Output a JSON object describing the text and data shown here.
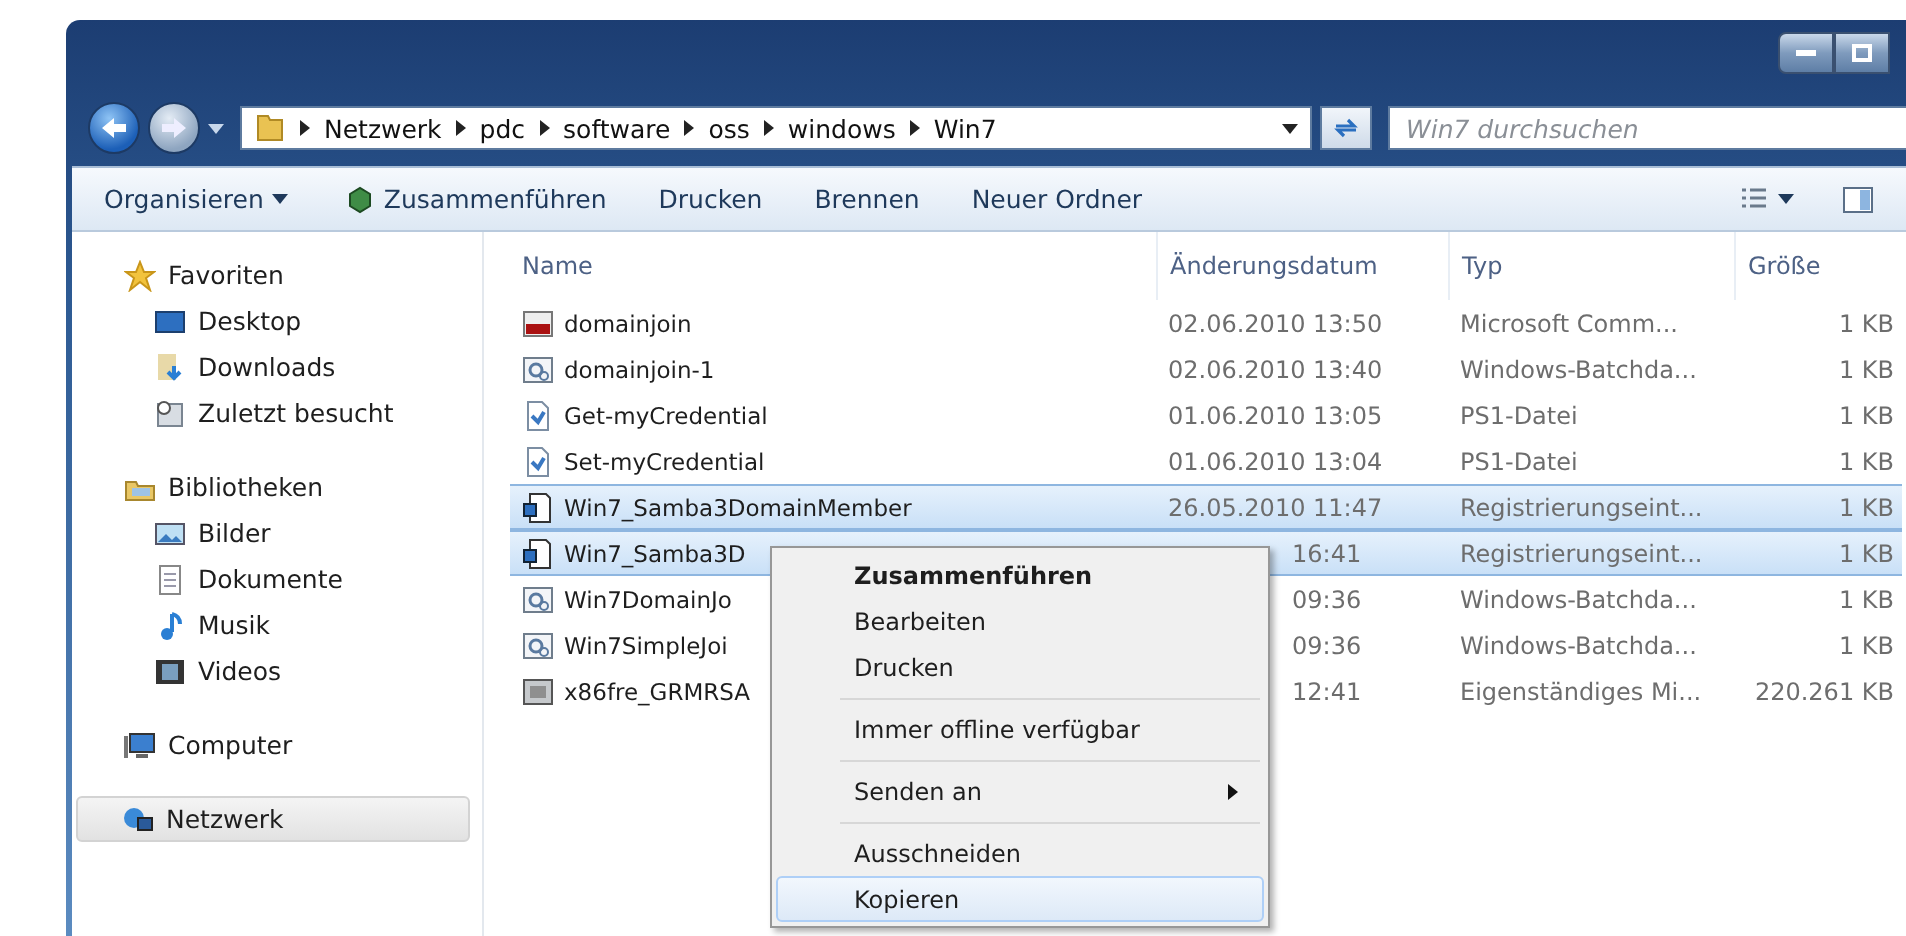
{
  "address_bar": {
    "path": [
      "Netzwerk",
      "pdc",
      "software",
      "oss",
      "windows",
      "Win7"
    ]
  },
  "search": {
    "placeholder": "Win7 durchsuchen"
  },
  "toolbar": {
    "items": [
      {
        "label": "Organisieren",
        "kind": "menu"
      },
      {
        "label": "Zusammenführen",
        "kind": "icon"
      },
      {
        "label": "Drucken",
        "kind": "plain"
      },
      {
        "label": "Brennen",
        "kind": "plain"
      },
      {
        "label": "Neuer Ordner",
        "kind": "plain"
      }
    ]
  },
  "sidebar": {
    "groups": [
      {
        "label": "Favoriten",
        "kind": "star",
        "selected": false,
        "children": [
          {
            "label": "Desktop",
            "kind": "desktop"
          },
          {
            "label": "Downloads",
            "kind": "downloads"
          },
          {
            "label": "Zuletzt besucht",
            "kind": "recent"
          }
        ]
      },
      {
        "label": "Bibliotheken",
        "kind": "library",
        "selected": false,
        "children": [
          {
            "label": "Bilder",
            "kind": "pictures"
          },
          {
            "label": "Dokumente",
            "kind": "documents"
          },
          {
            "label": "Musik",
            "kind": "music"
          },
          {
            "label": "Videos",
            "kind": "videos"
          }
        ]
      },
      {
        "label": "Computer",
        "kind": "computer",
        "selected": false
      },
      {
        "label": "Netzwerk",
        "kind": "network",
        "selected": true
      }
    ]
  },
  "table": {
    "columns": [
      "Name",
      "Änderungsdatum",
      "Typ",
      "Größe"
    ],
    "rows": [
      {
        "kind": "app",
        "name": "domainjoin",
        "date": "02.06.2010 13:50",
        "type": "Microsoft Comm...",
        "size": "1 KB",
        "selected": false,
        "partial": false
      },
      {
        "kind": "batch",
        "name": "domainjoin-1",
        "date": "02.06.2010 13:40",
        "type": "Windows-Batchda...",
        "size": "1 KB",
        "selected": false,
        "partial": false
      },
      {
        "kind": "script",
        "name": "Get-myCredential",
        "date": "01.06.2010 13:05",
        "type": "PS1-Datei",
        "size": "1 KB",
        "selected": false,
        "partial": false
      },
      {
        "kind": "script",
        "name": "Set-myCredential",
        "date": "01.06.2010 13:04",
        "type": "PS1-Datei",
        "size": "1 KB",
        "selected": false,
        "partial": false
      },
      {
        "kind": "registry",
        "name": "Win7_Samba3DomainMember",
        "date": "26.05.2010 11:47",
        "type": "Registrierungseint...",
        "size": "1 KB",
        "selected": true,
        "partial": false
      },
      {
        "kind": "registry",
        "name": "Win7_Samba3D",
        "date": "16:41",
        "type": "Registrierungseint...",
        "size": "1 KB",
        "selected": true,
        "partial": true
      },
      {
        "kind": "batch",
        "name": "Win7DomainJo",
        "date": "09:36",
        "type": "Windows-Batchda...",
        "size": "1 KB",
        "selected": false,
        "partial": true
      },
      {
        "kind": "batch",
        "name": "Win7SimpleJoi",
        "date": "09:36",
        "type": "Windows-Batchda...",
        "size": "1 KB",
        "selected": false,
        "partial": true
      },
      {
        "kind": "installer",
        "name": "x86fre_GRMRSA",
        "date": "12:41",
        "type": "Eigenständiges Mi...",
        "size": "220.261 KB",
        "selected": false,
        "partial": true
      }
    ]
  },
  "context_menu": {
    "sections": [
      [
        {
          "label": "Zusammenführen",
          "default": true,
          "submenu": false,
          "selected": false
        },
        {
          "label": "Bearbeiten",
          "default": false,
          "submenu": false,
          "selected": false
        },
        {
          "label": "Drucken",
          "default": false,
          "submenu": false,
          "selected": false
        }
      ],
      [
        {
          "label": "Immer offline verfügbar",
          "default": false,
          "submenu": false,
          "selected": false
        }
      ],
      [
        {
          "label": "Senden an",
          "default": false,
          "submenu": true,
          "selected": false
        }
      ],
      [
        {
          "label": "Ausschneiden",
          "default": false,
          "submenu": false,
          "selected": false
        },
        {
          "label": "Kopieren",
          "default": false,
          "submenu": false,
          "selected": true
        }
      ]
    ]
  }
}
